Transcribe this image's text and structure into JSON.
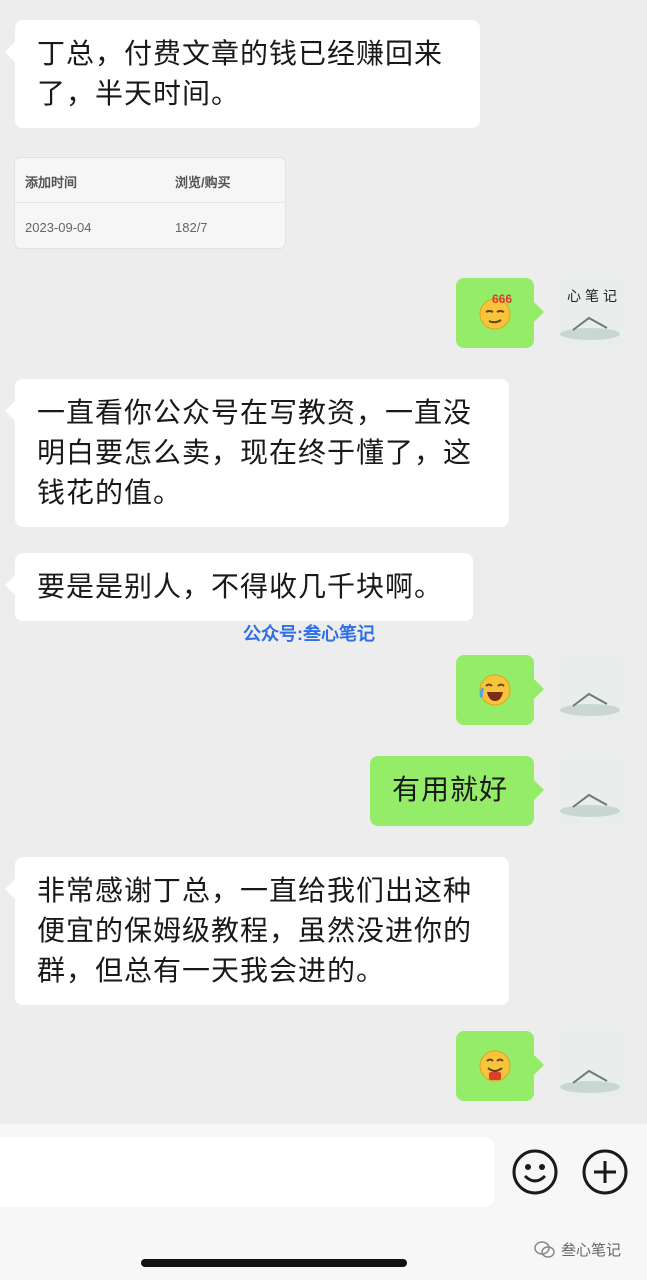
{
  "messages": [
    {
      "text": "丁总，付费文章的钱已经赚回来了，半天时间。"
    },
    {
      "text": "一直看你公众号在写教资，一直没明白要怎么卖，现在终于懂了，这钱花的值。"
    },
    {
      "text": "要是是别人，不得收几千块啊。"
    },
    {
      "text": "有用就好"
    },
    {
      "text": "非常感谢丁总，一直给我们出这种便宜的保姆级教程，虽然没进你的群，但总有一天我会进的。"
    }
  ],
  "stats_card": {
    "headers": [
      "添加时间",
      "浏览/购买"
    ],
    "row": [
      "2023-09-04",
      "182/7"
    ]
  },
  "emoji_badge": "666",
  "watermark": "公众号:叁心笔记",
  "brand": "叁心笔记",
  "avatar_caption": "心笔记",
  "icons": [
    "wechat-icon",
    "emoji-icon",
    "plus-icon"
  ]
}
